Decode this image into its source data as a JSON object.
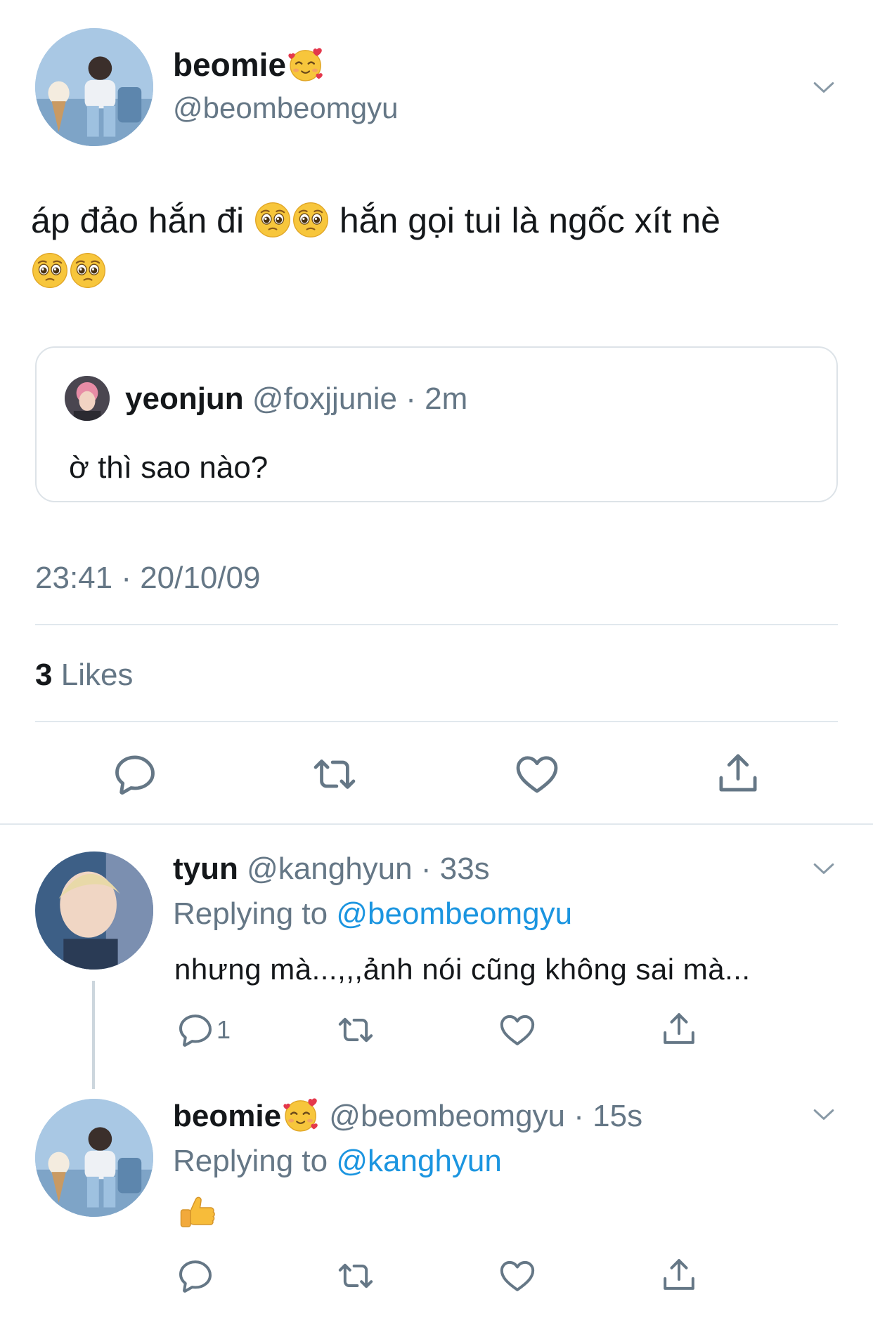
{
  "main_tweet": {
    "display_name": "beomie",
    "handle": "@beombeomgyu",
    "text_part1": "áp đảo hắn đi",
    "text_part2": "hắn gọi tui là ngốc xít nè",
    "quoted": {
      "name": "yeonjun",
      "handle": "@foxjjunie",
      "time": "· 2m",
      "text": "ờ thì sao nào?"
    },
    "timestamp": "23:41 · 20/10/09",
    "likes_count": "3",
    "likes_label": "Likes"
  },
  "replies": [
    {
      "display_name": "tyun",
      "handle": "@kanghyun",
      "time": "· 33s",
      "replying_label": "Replying to",
      "replying_to": "@beombeomgyu",
      "text": "nhưng mà...,,,ảnh nói cũng không sai mà...",
      "reply_count": "1"
    },
    {
      "display_name": "beomie",
      "handle": "@beombeomgyu",
      "time": "· 15s",
      "replying_label": "Replying to",
      "replying_to": "@kanghyun"
    }
  ],
  "icons": {
    "reply": "comment-icon",
    "retweet": "retweet-icon",
    "like": "heart-icon",
    "share": "share-icon",
    "menu": "chevron-down-icon"
  },
  "colors": {
    "text": "#14171a",
    "secondary": "#657786",
    "link": "#1b95e0",
    "divider": "#e1e8ed"
  }
}
